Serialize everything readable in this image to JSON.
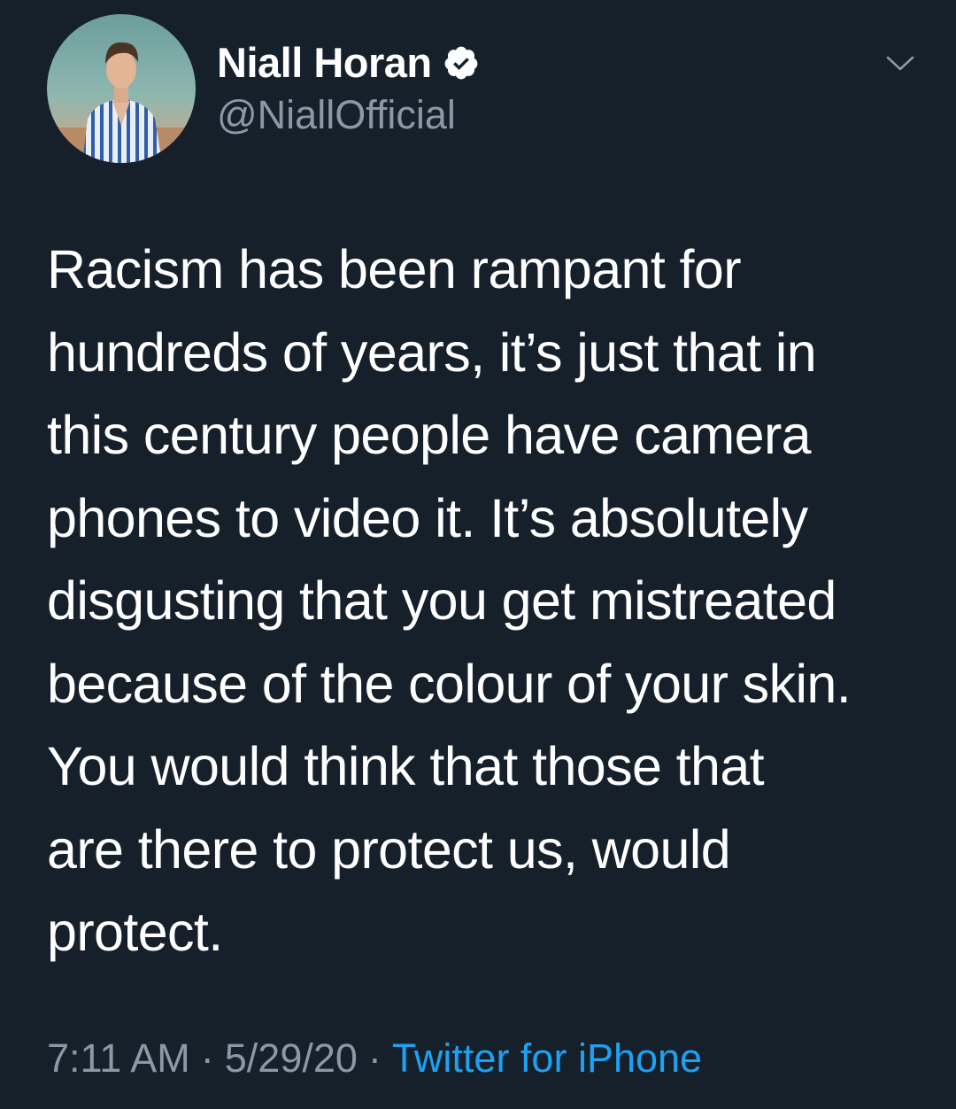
{
  "tweet": {
    "author": {
      "display_name": "Niall Horan",
      "handle": "@NiallOfficial",
      "verified": true,
      "avatar_icon": "profile-photo"
    },
    "menu_icon": "chevron-down-icon",
    "text": "Racism has been rampant for\nhundreds of years, it’s just that in\nthis century people have camera\nphones to video it. It’s absolutely\ndisgusting that you get mistreated\nbecause of the colour of your skin.\nYou would think that those that\nare there to protect us, would\nprotect.",
    "time": "7:11 AM",
    "date": "5/29/20",
    "separator": "·",
    "source": "Twitter for iPhone"
  },
  "colors": {
    "background": "#16202b",
    "text_primary": "#ffffff",
    "text_secondary": "#8b98a5",
    "link": "#1da1f2"
  }
}
